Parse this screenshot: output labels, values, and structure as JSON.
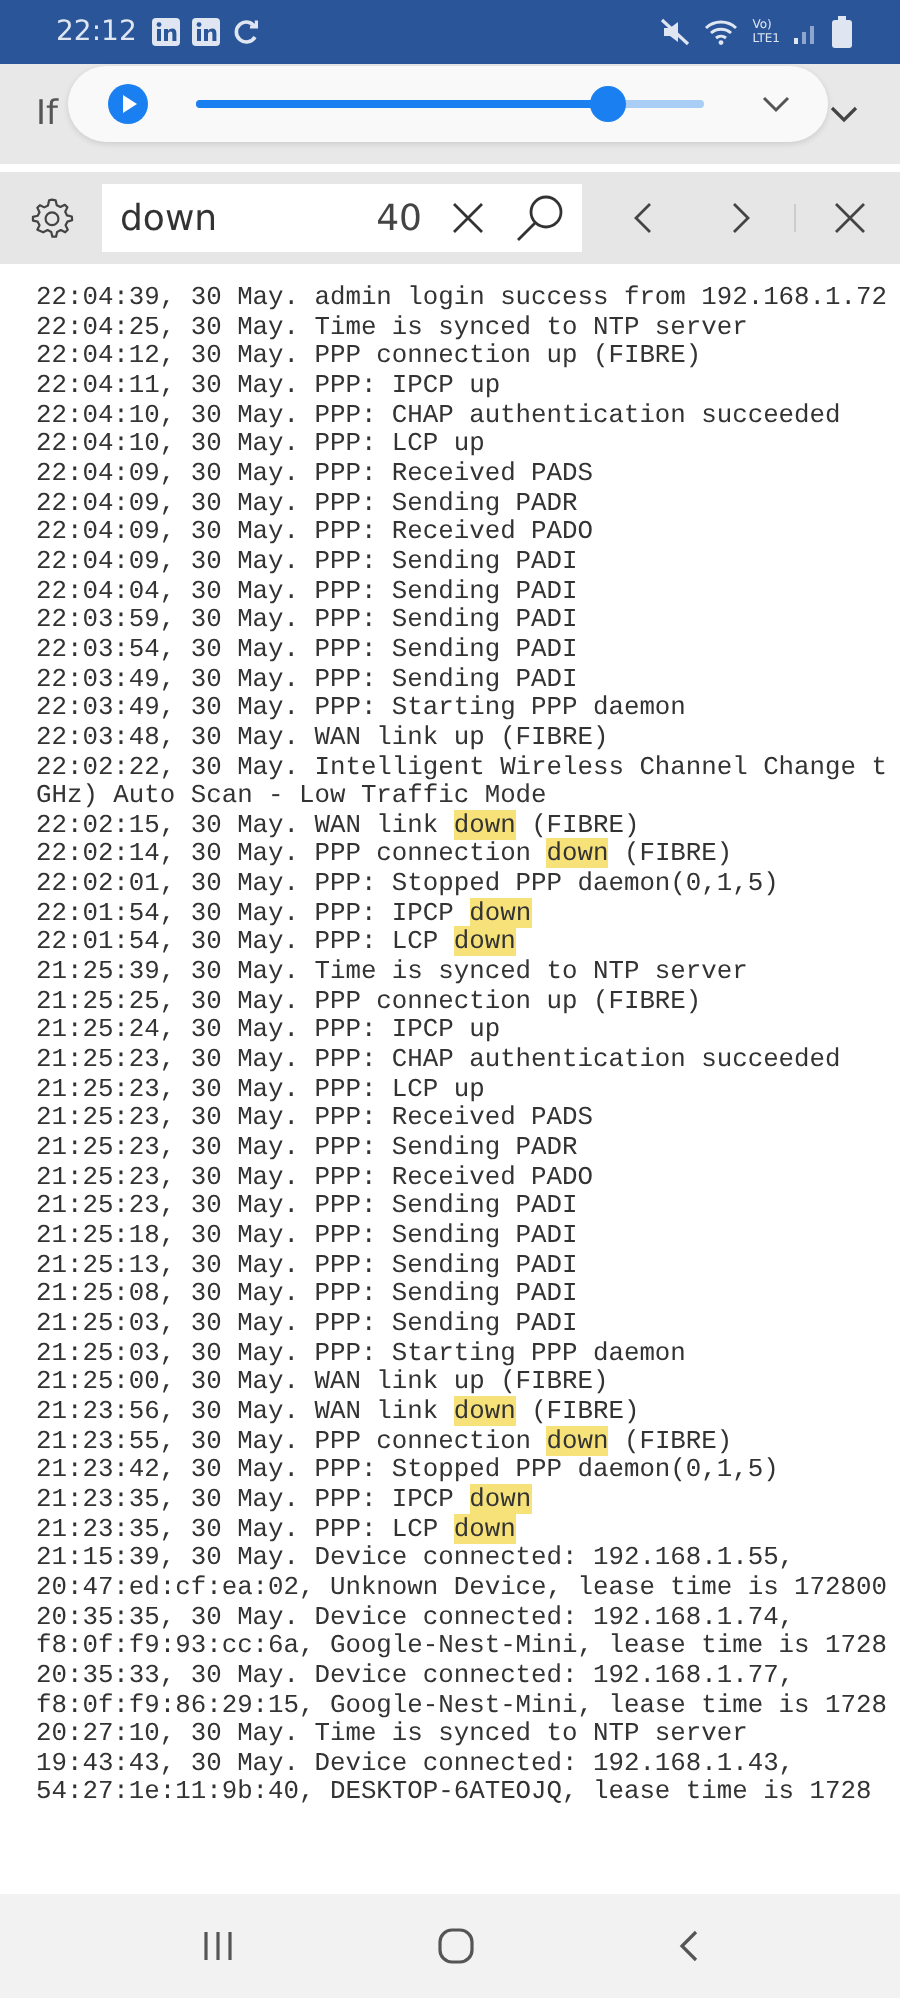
{
  "status_bar": {
    "time": "22:12",
    "volte_top": "Vo)",
    "volte_bottom": "LTE1"
  },
  "banner": {
    "text": "If"
  },
  "media_player": {
    "level": 0.81
  },
  "find_bar": {
    "value": "down",
    "count": "40"
  },
  "log_lines": [
    {
      "text": "22:04:39, 30 May. admin login success from 192.168.1.72"
    },
    {
      "text": "22:04:25, 30 May. Time is synced to NTP server"
    },
    {
      "text": "22:04:12, 30 May. PPP connection up (FIBRE)"
    },
    {
      "text": "22:04:11, 30 May. PPP: IPCP up"
    },
    {
      "text": "22:04:10, 30 May. PPP: CHAP authentication succeeded"
    },
    {
      "text": "22:04:10, 30 May. PPP: LCP up"
    },
    {
      "text": "22:04:09, 30 May. PPP: Received PADS"
    },
    {
      "text": "22:04:09, 30 May. PPP: Sending PADR"
    },
    {
      "text": "22:04:09, 30 May. PPP: Received PADO"
    },
    {
      "text": "22:04:09, 30 May. PPP: Sending PADI"
    },
    {
      "text": "22:04:04, 30 May. PPP: Sending PADI"
    },
    {
      "text": "22:03:59, 30 May. PPP: Sending PADI"
    },
    {
      "text": "22:03:54, 30 May. PPP: Sending PADI"
    },
    {
      "text": "22:03:49, 30 May. PPP: Sending PADI"
    },
    {
      "text": "22:03:49, 30 May. PPP: Starting PPP daemon"
    },
    {
      "text": "22:03:48, 30 May. WAN link up (FIBRE)"
    },
    {
      "text": "22:02:22, 30 May. Intelligent Wireless Channel Change t"
    },
    {
      "text": "GHz) Auto Scan - Low Traffic Mode"
    },
    {
      "before": "22:02:15, 30 May. WAN link ",
      "match": "down",
      "after": " (FIBRE)"
    },
    {
      "before": "22:02:14, 30 May. PPP connection ",
      "match": "down",
      "after": " (FIBRE)"
    },
    {
      "text": "22:02:01, 30 May. PPP: Stopped PPP daemon(0,1,5)"
    },
    {
      "before": "22:01:54, 30 May. PPP: IPCP ",
      "match": "down"
    },
    {
      "before": "22:01:54, 30 May. PPP: LCP ",
      "match": "down"
    },
    {
      "text": "21:25:39, 30 May. Time is synced to NTP server"
    },
    {
      "text": "21:25:25, 30 May. PPP connection up (FIBRE)"
    },
    {
      "text": "21:25:24, 30 May. PPP: IPCP up"
    },
    {
      "text": "21:25:23, 30 May. PPP: CHAP authentication succeeded"
    },
    {
      "text": "21:25:23, 30 May. PPP: LCP up"
    },
    {
      "text": "21:25:23, 30 May. PPP: Received PADS"
    },
    {
      "text": "21:25:23, 30 May. PPP: Sending PADR"
    },
    {
      "text": "21:25:23, 30 May. PPP: Received PADO"
    },
    {
      "text": "21:25:23, 30 May. PPP: Sending PADI"
    },
    {
      "text": "21:25:18, 30 May. PPP: Sending PADI"
    },
    {
      "text": "21:25:13, 30 May. PPP: Sending PADI"
    },
    {
      "text": "21:25:08, 30 May. PPP: Sending PADI"
    },
    {
      "text": "21:25:03, 30 May. PPP: Sending PADI"
    },
    {
      "text": "21:25:03, 30 May. PPP: Starting PPP daemon"
    },
    {
      "text": "21:25:00, 30 May. WAN link up (FIBRE)"
    },
    {
      "before": "21:23:56, 30 May. WAN link ",
      "match": "down",
      "after": " (FIBRE)"
    },
    {
      "before": "21:23:55, 30 May. PPP connection ",
      "match": "down",
      "after": " (FIBRE)"
    },
    {
      "text": "21:23:42, 30 May. PPP: Stopped PPP daemon(0,1,5)"
    },
    {
      "before": "21:23:35, 30 May. PPP: IPCP ",
      "match": "down"
    },
    {
      "before": "21:23:35, 30 May. PPP: LCP ",
      "match": "down"
    },
    {
      "text": "21:15:39, 30 May. Device connected: 192.168.1.55,"
    },
    {
      "text": "20:47:ed:cf:ea:02, Unknown Device, lease time is 172800"
    },
    {
      "text": "20:35:35, 30 May. Device connected: 192.168.1.74,"
    },
    {
      "text": "f8:0f:f9:93:cc:6a, Google-Nest-Mini, lease time is 1728"
    },
    {
      "text": "20:35:33, 30 May. Device connected: 192.168.1.77,"
    },
    {
      "text": "f8:0f:f9:86:29:15, Google-Nest-Mini, lease time is 1728"
    },
    {
      "text": "20:27:10, 30 May. Time is synced to NTP server"
    },
    {
      "text": "19:43:43, 30 May. Device connected: 192.168.1.43,"
    },
    {
      "text": "54:27:1e:11:9b:40, DESKTOP-6ATEOJQ, lease time is 1728"
    }
  ]
}
